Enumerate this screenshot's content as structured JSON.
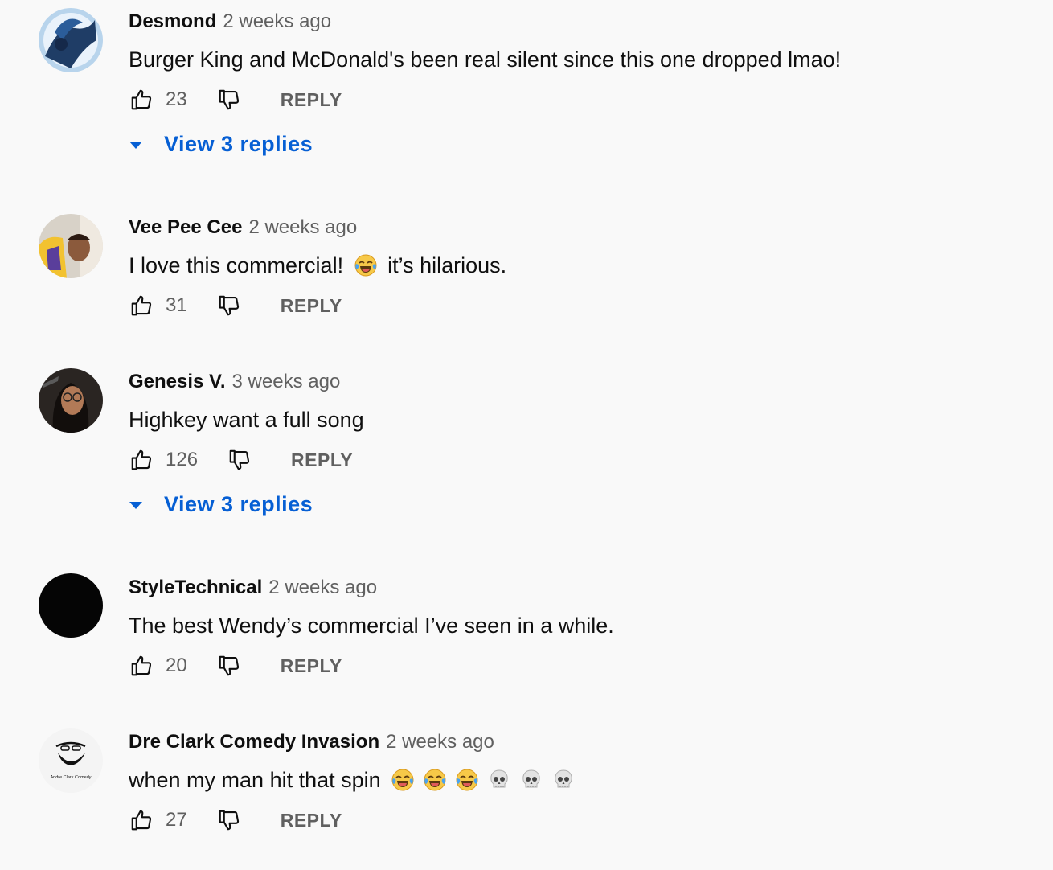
{
  "comments": [
    {
      "author": "Desmond",
      "time": "2 weeks ago",
      "text": "Burger King and McDonald's been real silent since this one dropped lmao!",
      "likes": "23",
      "reply_label": "REPLY",
      "replies_label": "View 3 replies"
    },
    {
      "author": "Vee Pee Cee",
      "time": "2 weeks ago",
      "text_before": "I love this commercial!",
      "text_after": "it’s hilarious.",
      "likes": "31",
      "reply_label": "REPLY"
    },
    {
      "author": "Genesis V.",
      "time": "3 weeks ago",
      "text": "Highkey want a full song",
      "likes": "126",
      "reply_label": "REPLY",
      "replies_label": "View 3 replies"
    },
    {
      "author": "StyleTechnical",
      "time": "2 weeks ago",
      "text": "The best Wendy’s commercial I’ve seen in a while.",
      "likes": "20",
      "reply_label": "REPLY"
    },
    {
      "author": "Dre Clark Comedy Invasion",
      "time": "2 weeks ago",
      "text": "when my man hit that spin",
      "avatar_caption": "Andre Clark Comedy",
      "likes": "27",
      "reply_label": "REPLY"
    }
  ],
  "icons": {
    "like": "thumbs-up-icon",
    "dislike": "thumbs-down-icon",
    "expand": "caret-down-icon",
    "laugh_emoji": "face-with-tears-of-joy-emoji",
    "skull_emoji": "skull-emoji"
  },
  "colors": {
    "background": "#f9f9f9",
    "link": "#065fd4",
    "secondary_text": "#606060"
  }
}
